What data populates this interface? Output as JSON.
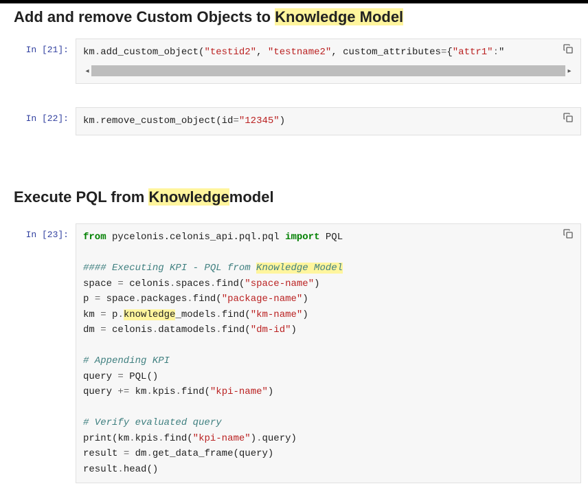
{
  "heading1_a": "Add and remove Custom Objects to ",
  "heading1_b": "Knowledge Model",
  "heading2_a": "Execute PQL from ",
  "heading2_b": "Knowledge",
  "heading2_c": "model",
  "cells": [
    {
      "prompt": "In [21]:",
      "has_scroll": true
    },
    {
      "prompt": "In [22]:",
      "has_scroll": false
    },
    {
      "prompt": "In [23]:",
      "has_scroll": false
    }
  ],
  "code21": {
    "n1": "km",
    "o1": ".",
    "n2": "add_custom_object",
    "p1": "(",
    "s1": "\"testid2\"",
    "p2": ", ",
    "s2": "\"testname2\"",
    "p3": ", ",
    "n3": "custom_attributes",
    "o2": "=",
    "p4": "{",
    "s3": "\"attr1\"",
    "o3": ":",
    "p5": "\""
  },
  "code22": {
    "n1": "km",
    "o1": ".",
    "n2": "remove_custom_object",
    "p1": "(",
    "n3": "id",
    "o2": "=",
    "s1": "\"12345\"",
    "p2": ")"
  },
  "code23": {
    "k1": "from",
    "sp1": " ",
    "nn1": "pycelonis.celonis_api.pql.pql",
    "sp2": " ",
    "k2": "import",
    "sp3": " ",
    "n1": "PQL",
    "c1_a": "#### Executing KPI - PQL from ",
    "c1_b": "Knowledge Model",
    "n2": "space",
    "sp4": " ",
    "o1": "=",
    "sp5": " ",
    "n3": "celonis",
    "o2": ".",
    "n4": "spaces",
    "o3": ".",
    "n5": "find",
    "p1": "(",
    "s1": "\"space-name\"",
    "p2": ")",
    "n6": "p",
    "sp6": " ",
    "o4": "=",
    "sp7": " ",
    "n7": "space",
    "o5": ".",
    "n8": "packages",
    "o6": ".",
    "n9": "find",
    "p3": "(",
    "s2": "\"package-name\"",
    "p4": ")",
    "n10": "km",
    "sp8": " ",
    "o7": "=",
    "sp9": " ",
    "n11": "p",
    "o8": ".",
    "n12": "knowledge_models",
    "n12a": "knowledge",
    "n12b": "_models",
    "o9": ".",
    "n13": "find",
    "p5": "(",
    "s3": "\"km-name\"",
    "p6": ")",
    "n14": "dm",
    "sp10": " ",
    "o10": "=",
    "sp11": " ",
    "n15": "celonis",
    "o11": ".",
    "n16": "datamodels",
    "o12": ".",
    "n17": "find",
    "p7": "(",
    "s4": "\"dm-id\"",
    "p8": ")",
    "c2": "# Appending KPI",
    "n18": "query",
    "sp12": " ",
    "o13": "=",
    "sp13": " ",
    "n19": "PQL",
    "p9": "()",
    "n20": "query",
    "sp14": " ",
    "o14": "+=",
    "sp15": " ",
    "n21": "km",
    "o15": ".",
    "n22": "kpis",
    "o16": ".",
    "n23": "find",
    "p10": "(",
    "s5": "\"kpi-name\"",
    "p11": ")",
    "c3": "# Verify evaluated query",
    "n24": "print",
    "p12": "(",
    "n25": "km",
    "o17": ".",
    "n26": "kpis",
    "o18": ".",
    "n27": "find",
    "p13": "(",
    "s6": "\"kpi-name\"",
    "p14": ")",
    "o19": ".",
    "n28": "query",
    "p15": ")",
    "n29": "result",
    "sp16": " ",
    "o20": "=",
    "sp17": " ",
    "n30": "dm",
    "o21": ".",
    "n31": "get_data_frame",
    "p16": "(",
    "n32": "query",
    "p17": ")",
    "n33": "result",
    "o22": ".",
    "n34": "head",
    "p18": "()"
  }
}
